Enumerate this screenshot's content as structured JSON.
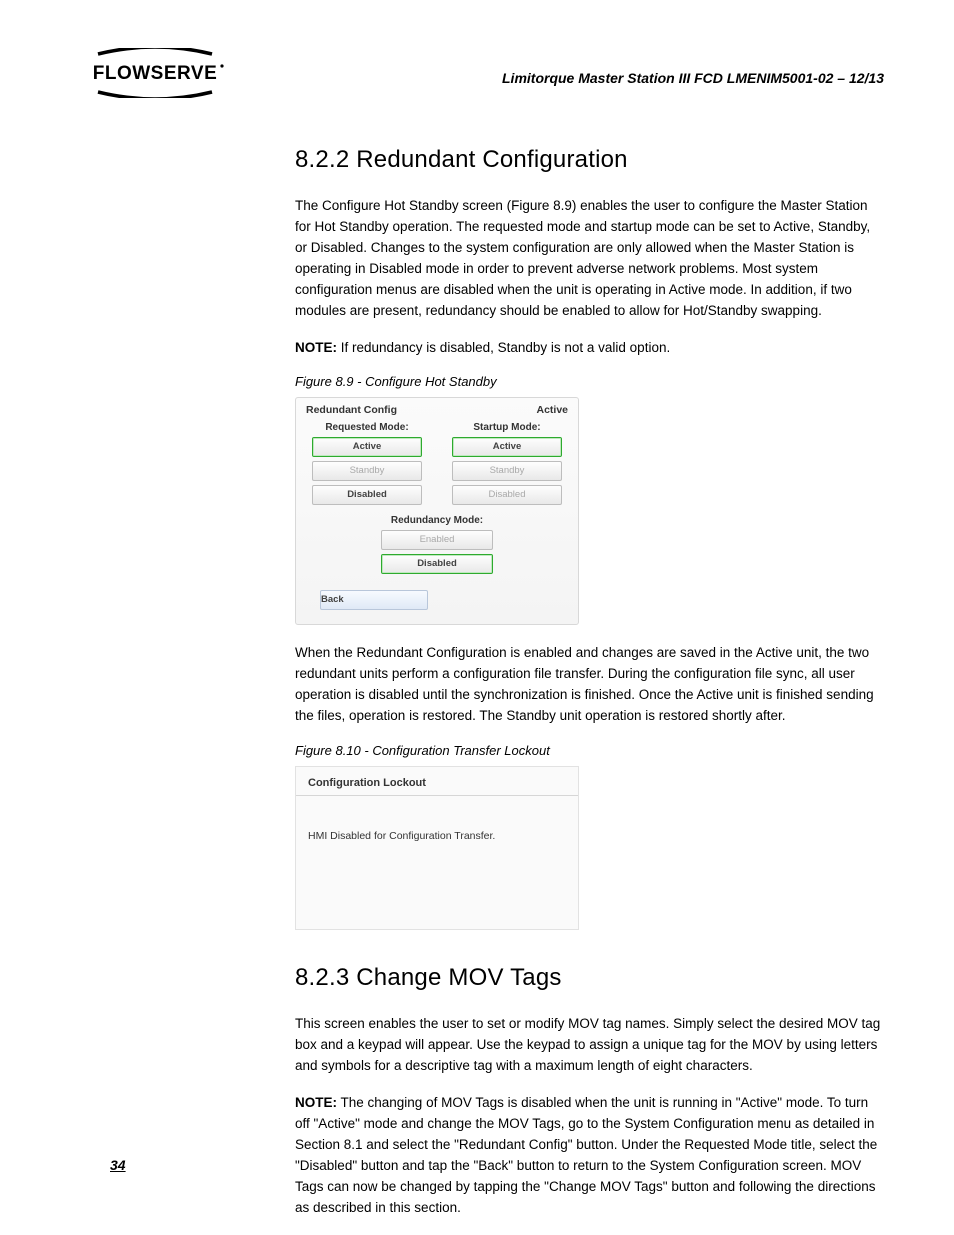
{
  "header": {
    "doc_title": "Limitorque Master Station III    FCD LMENIM5001-02 – 12/13",
    "logo_text": "FLOWSERVE"
  },
  "section822": {
    "heading": "8.2.2 Redundant Configuration",
    "para1": "The Configure Hot Standby screen (Figure 8.9) enables the user to configure the Master Station for Hot Standby operation. The requested mode and startup mode can be set to Active, Standby, or Disabled. Changes to the system configuration are only allowed when the Master Station is operating in Disabled mode in order to prevent adverse network problems. Most system configuration menus are disabled when the unit is operating in Active mode. In addition, if two modules are present, redundancy should be enabled to allow for Hot/Standby swapping.",
    "note_label": "NOTE:",
    "note_text": " If redundancy is disabled, Standby is not a valid option.",
    "fig89_caption": "Figure 8.9 - Configure Hot Standby",
    "panel89": {
      "title": "Redundant Config",
      "status": "Active",
      "requested_label": "Requested Mode:",
      "startup_label": "Startup Mode:",
      "active": "Active",
      "standby": "Standby",
      "disabled": "Disabled",
      "redundancy_label": "Redundancy Mode:",
      "enabled": "Enabled",
      "back": "Back"
    },
    "para2": "When the Redundant Configuration is enabled and changes are saved in the Active unit, the two redundant units perform a configuration file transfer. During the configuration file sync, all user operation is disabled until the synchronization is finished. Once the Active unit is finished sending the files, operation is restored. The Standby unit operation is restored shortly after.",
    "fig810_caption": "Figure 8.10 - Configuration Transfer Lockout",
    "panel810": {
      "title": "Configuration Lockout",
      "message": "HMI Disabled for Configuration Transfer."
    }
  },
  "section823": {
    "heading": "8.2.3 Change MOV Tags",
    "para1": "This screen enables the user to set or modify MOV tag names. Simply select the desired MOV tag box and a keypad will appear. Use the keypad to assign a unique tag for the MOV by using letters and symbols for a descriptive tag with a maximum length of eight characters.",
    "note_label": "NOTE:",
    "note_text": " The changing of MOV Tags is disabled when the unit is running in \"Active\" mode. To turn off \"Active\" mode and change the MOV Tags, go to the System Configuration menu as detailed in Section 8.1 and select the \"Redundant Config\" button. Under the Requested Mode title, select the \"Disabled\" button and tap the \"Back\" button to return to the System Configuration screen. MOV Tags can now be changed by tapping the \"Change MOV Tags\" button and following the directions as described in this section."
  },
  "page_number": "34"
}
